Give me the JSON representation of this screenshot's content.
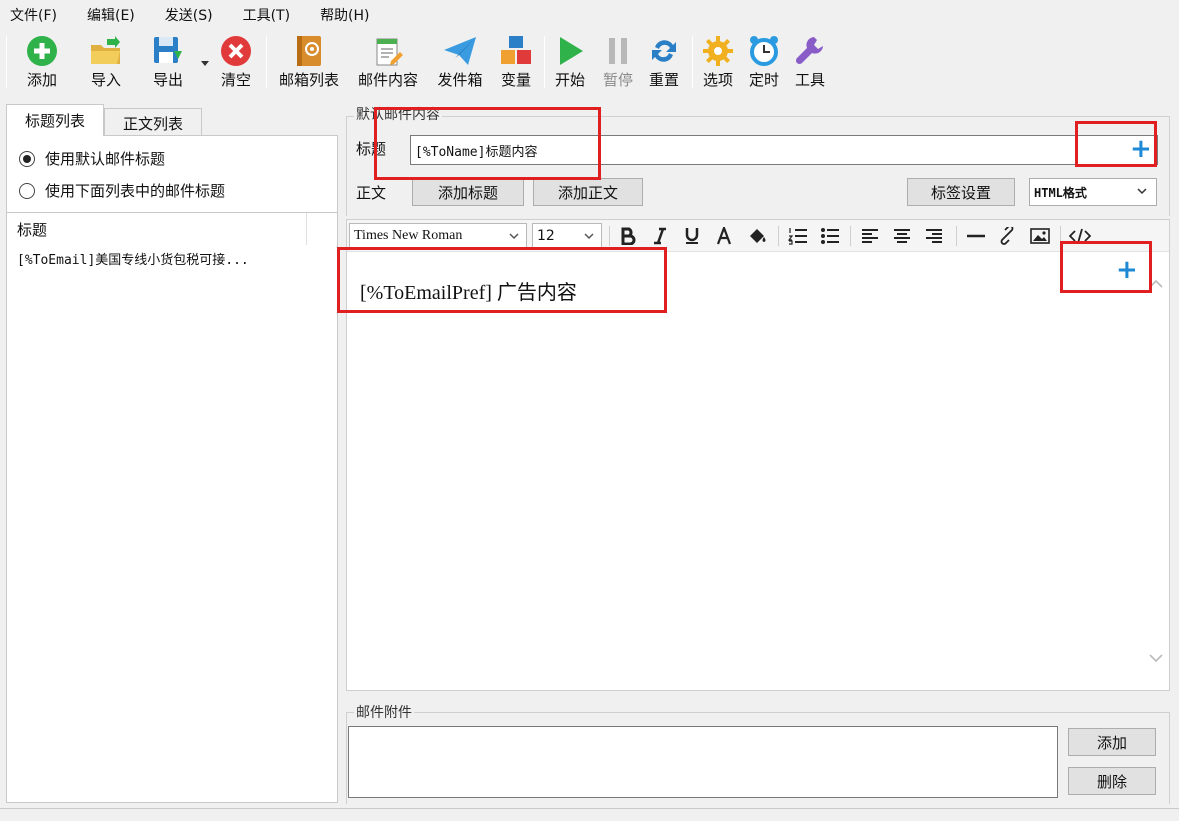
{
  "menu": [
    "文件(F)",
    "编辑(E)",
    "发送(S)",
    "工具(T)",
    "帮助(H)"
  ],
  "toolbar": {
    "add": "添加",
    "import": "导入",
    "export": "导出",
    "clear": "清空",
    "mailbox_list": "邮箱列表",
    "mail_content": "邮件内容",
    "sender_box": "发件箱",
    "variables": "变量",
    "start": "开始",
    "pause": "暂停",
    "reset": "重置",
    "options": "选项",
    "timer": "定时",
    "tools": "工具"
  },
  "left_panel": {
    "tabs": [
      "标题列表",
      "正文列表"
    ],
    "radio_default": "使用默认邮件标题",
    "radio_list": "使用下面列表中的邮件标题",
    "list_header": "标题",
    "list_rows": [
      "[%ToEmail]美国专线小货包税可接..."
    ]
  },
  "default_content": {
    "group_title": "默认邮件内容",
    "subject_label": "标题",
    "subject_value": "[%ToName]标题内容",
    "body_label": "正文",
    "add_subject_button": "添加标题",
    "add_body_button": "添加正文",
    "tag_settings_button": "标签设置",
    "format_value": "HTML格式"
  },
  "editor": {
    "font_family": "Times New Roman",
    "font_size": "12",
    "content": "[%ToEmailPref] 广告内容"
  },
  "attachments": {
    "group_title": "邮件附件",
    "add_button": "添加",
    "delete_button": "删除"
  },
  "annotations": {
    "plus_symbol": "+"
  },
  "colors": {
    "annotation_red": "#e02020",
    "plus_blue": "#1e8ad6"
  }
}
